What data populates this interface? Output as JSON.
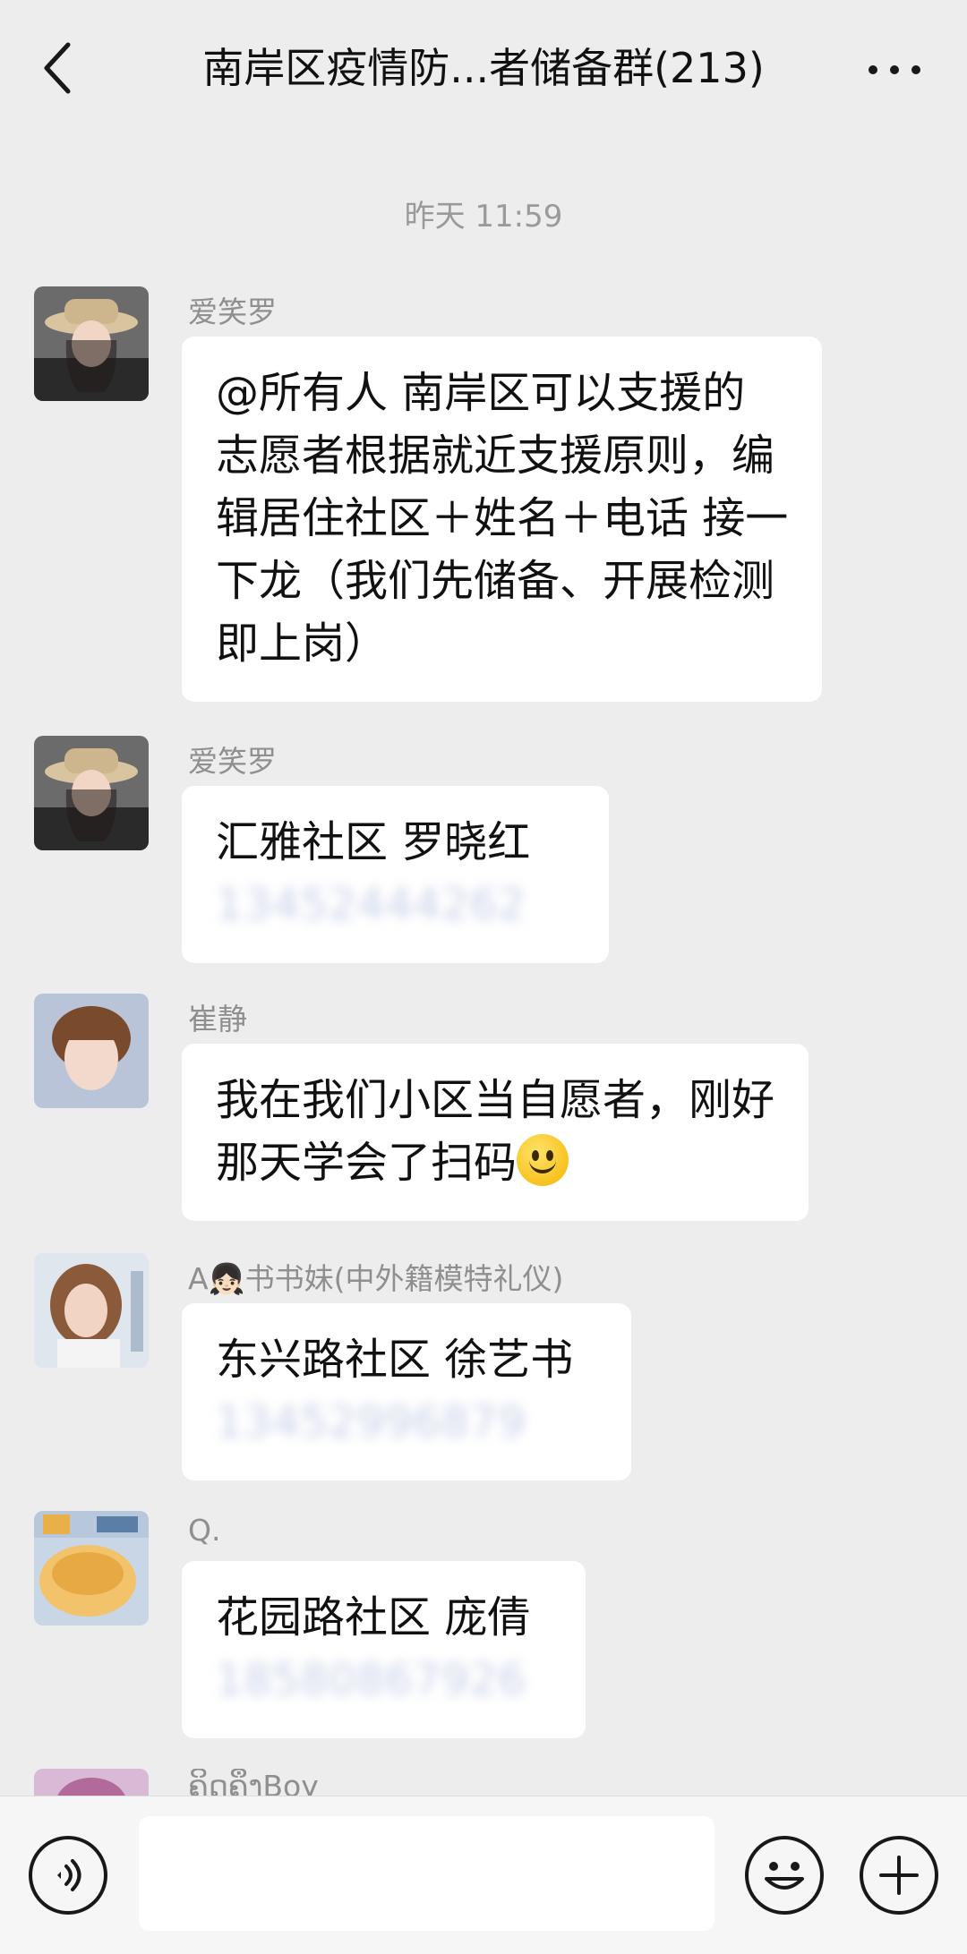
{
  "header": {
    "title": "南岸区疫情防...者储备群(213)"
  },
  "timestamp": "昨天 11:59",
  "messages": [
    {
      "sender": "爱笑罗",
      "lines": [
        "@所有人  南岸区可以支援的",
        "志愿者根据就近支援原则，编",
        "辑居住社区＋姓名＋电话 接一",
        "下龙（我们先储备、开展检测",
        "即上岗）"
      ]
    },
    {
      "sender": "爱笑罗",
      "lines": [
        "汇雅社区 罗晓红"
      ],
      "blurred": "13452444262"
    },
    {
      "sender": "崔静",
      "lines": [
        "我在我们小区当自愿者，刚好",
        "那天学会了扫码"
      ],
      "emoji": "smile-emoji"
    },
    {
      "sender": "A👧🏻书书妹(中外籍模特礼仪)",
      "lines": [
        "东兴路社区 徐艺书"
      ],
      "blurred": "13452996879"
    },
    {
      "sender": "Q.",
      "lines": [
        "花园路社区 庞倩"
      ],
      "blurred": "18580867926"
    },
    {
      "sender": "ຄິດຄຶງBoy"
    }
  ],
  "colors": {
    "background": "#ededed",
    "bubble": "#ffffff",
    "sender": "#8f8f8f",
    "timestamp": "#9a9a9a"
  },
  "icons": {
    "back": "chevron-left-icon",
    "more": "ellipsis-icon",
    "voice": "voice-icon",
    "emoji": "emoji-icon",
    "plus": "plus-icon"
  }
}
